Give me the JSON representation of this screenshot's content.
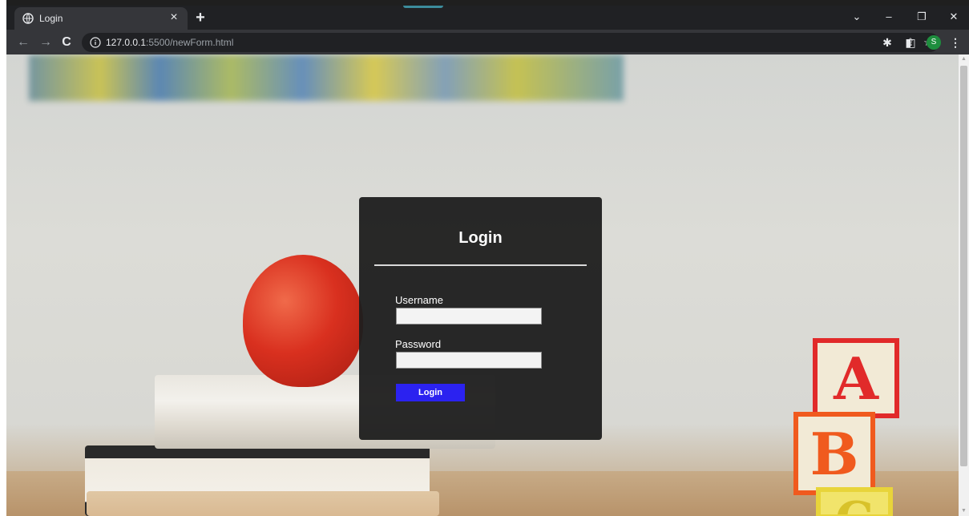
{
  "window": {
    "tab_title": "Login",
    "tab_close": "×",
    "new_tab": "+",
    "controls": {
      "dropdown": "⌄",
      "minimize": "–",
      "restore": "❐",
      "close": "✕"
    }
  },
  "toolbar": {
    "back": "←",
    "forward": "→",
    "reload": "C",
    "url_host": "127.0.0.1",
    "url_rest": ":5500/newForm.html",
    "share": "⇪",
    "star": "☆",
    "extensions": "✱",
    "sidepanel": "◧",
    "profile_initial": "S",
    "menu": "⋮"
  },
  "login": {
    "title": "Login",
    "username_label": "Username",
    "username_value": "",
    "password_label": "Password",
    "password_value": "",
    "button_label": "Login"
  },
  "background": {
    "block_a": "A",
    "block_b": "B",
    "block_c": "C"
  }
}
